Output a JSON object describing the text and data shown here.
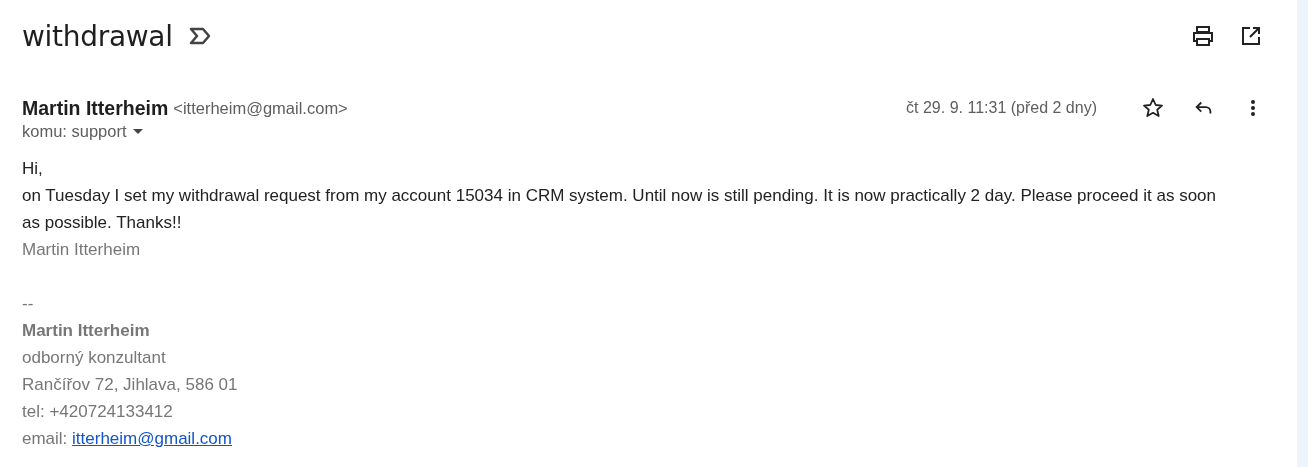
{
  "subject": "withdrawal",
  "message": {
    "sender_name": "Martin Itterheim",
    "sender_email": "<itterheim@gmail.com>",
    "recipient": "komu: support",
    "date": "čt 29. 9. 11:31 (před 2 dny)",
    "starred": false,
    "body": [
      "Hi,",
      "on Tuesday I set my withdrawal request from my account 15034 in CRM system. Until now is still pending. It is now practically 2 day. Please proceed it as soon as possible. Thanks!!"
    ],
    "signature_name": "Martin Itterheim",
    "signature": {
      "separator": "--",
      "name": "Martin Itterheim",
      "lines": [
        "odborný konzultant",
        "Rančířov 72, Jihlava, 586 01",
        "tel: +420724133412"
      ],
      "email_label": "email: ",
      "email_link": "itterheim@gmail.com"
    }
  }
}
